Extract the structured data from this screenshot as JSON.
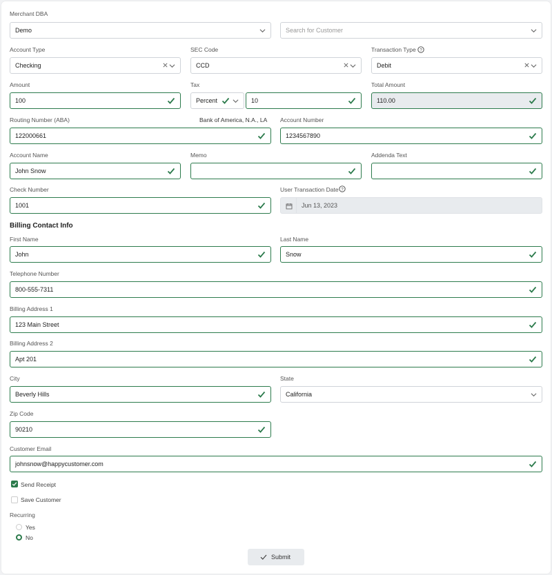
{
  "merchant": {
    "label": "Merchant DBA",
    "value": "Demo",
    "customer_placeholder": "Search for Customer"
  },
  "account_type": {
    "label": "Account Type",
    "value": "Checking"
  },
  "sec_code": {
    "label": "SEC Code",
    "value": "CCD"
  },
  "transaction_type": {
    "label": "Transaction Type",
    "value": "Debit"
  },
  "amount": {
    "label": "Amount",
    "value": "100"
  },
  "tax": {
    "label": "Tax",
    "mode": "Percent",
    "value": "10"
  },
  "total_amount": {
    "label": "Total Amount",
    "value": "110.00"
  },
  "routing": {
    "label": "Routing Number (ABA)",
    "bank": "Bank of America, N.A., LA",
    "value": "122000661"
  },
  "account_number": {
    "label": "Account Number",
    "value": "1234567890"
  },
  "account_name": {
    "label": "Account Name",
    "value": "John Snow"
  },
  "memo": {
    "label": "Memo",
    "value": ""
  },
  "addenda": {
    "label": "Addenda Text",
    "value": ""
  },
  "check_number": {
    "label": "Check Number",
    "value": "1001"
  },
  "user_date": {
    "label": "User Transaction Date",
    "value": "Jun 13, 2023"
  },
  "billing": {
    "title": "Billing Contact Info",
    "first_name": {
      "label": "First Name",
      "value": "John"
    },
    "last_name": {
      "label": "Last Name",
      "value": "Snow"
    },
    "telephone": {
      "label": "Telephone Number",
      "value": "800-555-7311"
    },
    "address1": {
      "label": "Billing Address 1",
      "value": "123 Main Street"
    },
    "address2": {
      "label": "Billing Address 2",
      "value": "Apt 201"
    },
    "city": {
      "label": "City",
      "value": "Beverly Hills"
    },
    "state": {
      "label": "State",
      "value": "California"
    },
    "zip": {
      "label": "Zip Code",
      "value": "90210"
    },
    "email": {
      "label": "Customer Email",
      "value": "johnsnow@happycustomer.com"
    }
  },
  "options": {
    "send_receipt": "Send Receipt",
    "save_customer": "Save Customer"
  },
  "recurring": {
    "label": "Recurring",
    "yes": "Yes",
    "no": "No"
  },
  "submit_label": "Submit",
  "colors": {
    "accent": "#2b7a4b",
    "border": "#cfd3d8",
    "disabled_bg": "#e8ebee"
  }
}
